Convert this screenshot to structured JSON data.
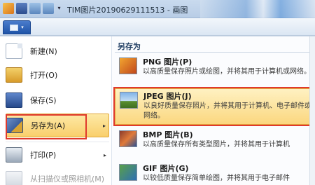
{
  "window": {
    "title": "TIM图片20190629111513 - 画图",
    "qat_dropdown": "▾"
  },
  "ribbon": {
    "file_arrow": "▾"
  },
  "file_menu": {
    "items": [
      {
        "label": "新建(N)",
        "icon": "new-document-icon"
      },
      {
        "label": "打开(O)",
        "icon": "open-folder-icon"
      },
      {
        "label": "保存(S)",
        "icon": "save-disk-icon"
      },
      {
        "label": "另存为(A)",
        "icon": "save-as-icon",
        "submenu_arrow": "▸"
      },
      {
        "label": "打印(P)",
        "icon": "printer-icon",
        "submenu_arrow": "▸"
      },
      {
        "label": "从扫描仪或照相机(M)",
        "icon": "scanner-icon"
      }
    ]
  },
  "save_as_panel": {
    "heading": "另存为",
    "options": [
      {
        "title": "PNG 图片(P)",
        "desc": "以高质量保存照片或绘图，并将其用于计算机或网络。",
        "icon": "png-image-icon"
      },
      {
        "title": "JPEG 图片(J)",
        "desc": "以良好质量保存照片，并将其用于计算机、电子邮件或网络。",
        "icon": "jpeg-image-icon"
      },
      {
        "title": "BMP 图片(B)",
        "desc": "以高质量保存所有类型图片，并将其用于计算机",
        "icon": "bmp-image-icon"
      },
      {
        "title": "GIF 图片(G)",
        "desc": "以较低质量保存简单绘图，并将其用于电子邮件",
        "icon": "gif-image-icon"
      }
    ]
  },
  "colors": {
    "highlight": "#f9cf6c",
    "annotation_red": "#e03a2d"
  }
}
